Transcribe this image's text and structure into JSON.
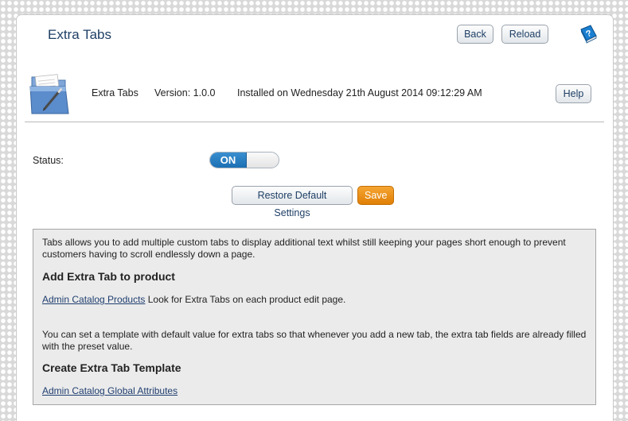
{
  "header": {
    "title": "Extra Tabs",
    "back_label": "Back",
    "reload_label": "Reload",
    "help_icon": "help-book-icon"
  },
  "module": {
    "icon": "folder-document-icon",
    "name": "Extra Tabs",
    "version": "Version: 1.0.0",
    "installed": "Installed on Wednesday 21th August 2014 09:12:29 AM",
    "help_label": "Help"
  },
  "settings": {
    "status_label": "Status:",
    "status_toggle": "ON",
    "status_on": true,
    "restore_label": "Restore Default Settings",
    "save_label": "Save"
  },
  "info": {
    "intro": "Tabs allows you to add multiple custom tabs to display additional text whilst still keeping your pages short enough to prevent customers having to scroll endlessly down a page.",
    "heading1": "Add Extra Tab to product",
    "link1": "Admin Catalog Products",
    "link1_suffix": " Look for Extra Tabs on each product edit page.",
    "para2": "You can set a template with default value for extra tabs so that whenever you add a new tab, the extra tab fields are already filled with the preset value.",
    "heading2": "Create Extra Tab Template",
    "link2": "Admin Catalog Global Attributes"
  },
  "colors": {
    "title": "#1e3f66",
    "toggle_on": "#1b6fb3",
    "save_button": "#e88a0c",
    "infobox_bg": "#ebebeb"
  }
}
